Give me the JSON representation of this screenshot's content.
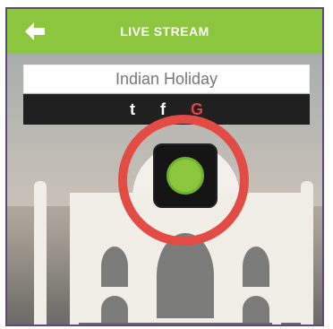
{
  "header": {
    "title": "LIVE STREAM"
  },
  "stream": {
    "name": "Indian Holiday"
  },
  "share": {
    "facebook_label": "f",
    "google_label": "G",
    "twitter_label": "t"
  },
  "colors": {
    "accent": "#8cc63f",
    "highlight": "#e24c45",
    "bar": "#202020"
  }
}
